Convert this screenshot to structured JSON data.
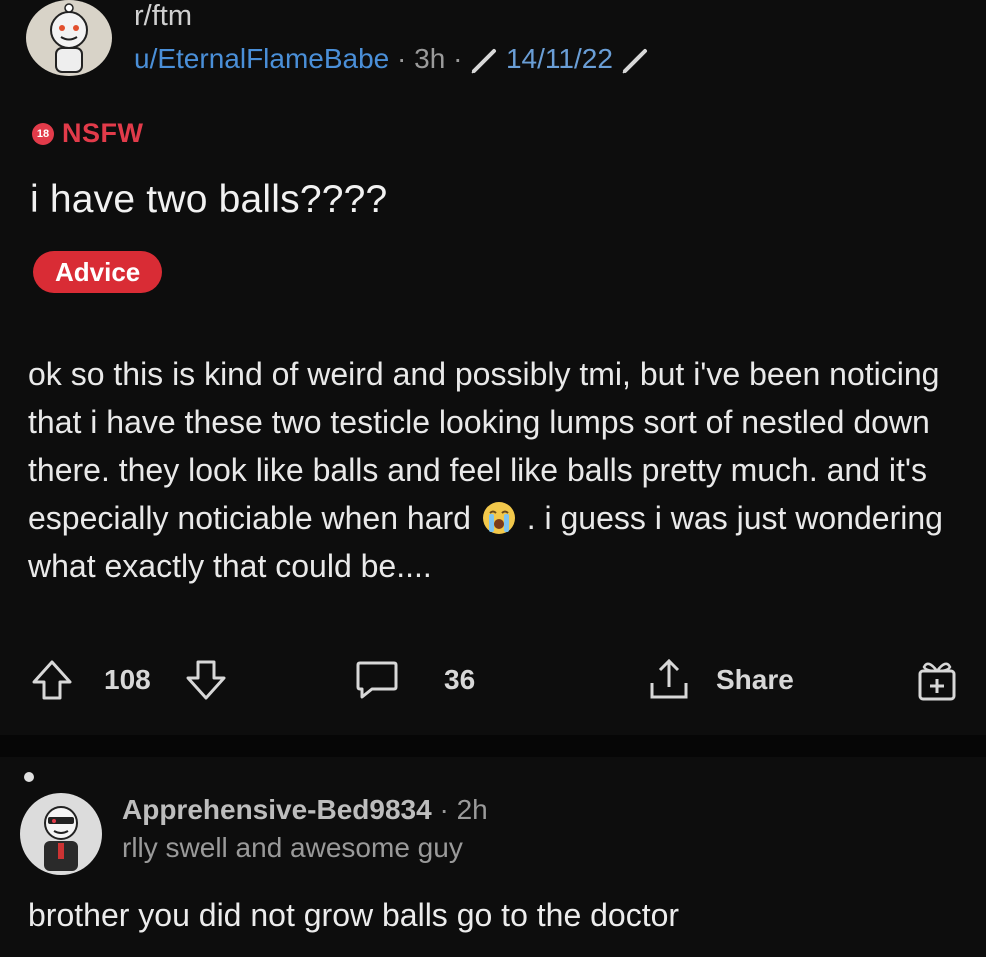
{
  "post": {
    "subreddit": "r/ftm",
    "username": "u/EternalFlameBabe",
    "separator": "·",
    "age": "3h",
    "user_flair": "14/11/22",
    "nsfw_badge": "18",
    "nsfw_label": "NSFW",
    "title": "i have two balls????",
    "post_flair": "Advice",
    "body_part1": "ok so this is kind of weird and possibly tmi, but i've been noticing that i have these two testicle looking lumps sort of nestled down there. they look like balls and feel like balls pretty much. and it's especially noticiable when hard",
    "body_part2": ". i guess i was just wondering what exactly that could be....",
    "emoji": "loudly-crying-face",
    "icons": {
      "upvote": "upvote-icon",
      "downvote": "downvote-icon",
      "comment": "comment-bubble-icon",
      "share": "share-icon",
      "award": "award-gift-icon",
      "flair_decoration": "syringe-icon"
    }
  },
  "actions": {
    "votes": "108",
    "comments": "36",
    "share_label": "Share"
  },
  "comment": {
    "username": "Apprehensive-Bed9834",
    "separator": "·",
    "age": "2h",
    "user_flair": "rlly swell and awesome guy",
    "text": "brother you did not grow balls go to the doctor"
  },
  "colors": {
    "background": "#0d0d0d",
    "nsfw_red": "#e23b4a",
    "flair_red": "#d92c35",
    "username_blue": "#4a8fd8"
  }
}
